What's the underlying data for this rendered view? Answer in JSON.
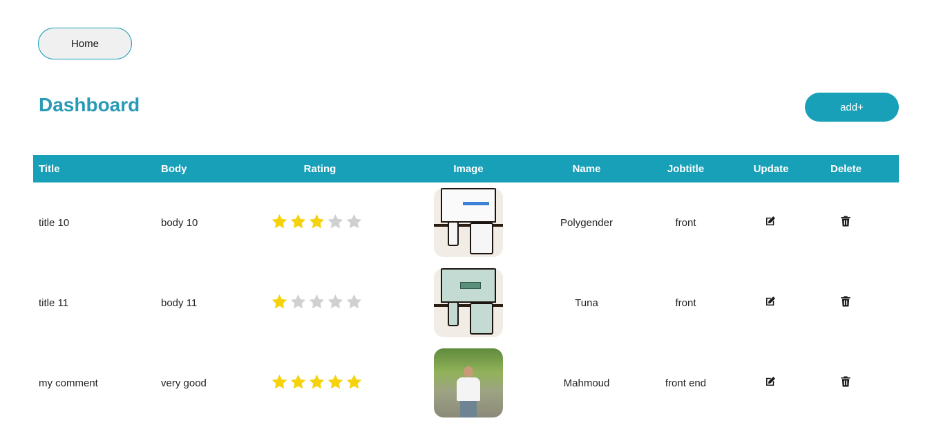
{
  "nav": {
    "home_label": "Home"
  },
  "header": {
    "title": "Dashboard",
    "add_label": "add+"
  },
  "table": {
    "columns": [
      "Title",
      "Body",
      "Rating",
      "Image",
      "Name",
      "Jobtitle",
      "Update",
      "Delete"
    ],
    "rows": [
      {
        "title": "title 10",
        "body": "body 10",
        "rating": 3,
        "image": "devices-mockup-white",
        "name": "Polygender",
        "jobtitle": "front"
      },
      {
        "title": "title 11",
        "body": "body 11",
        "rating": 1,
        "image": "devices-mockup-mint",
        "name": "Tuna",
        "jobtitle": "front"
      },
      {
        "title": "my comment",
        "body": "very good",
        "rating": 5,
        "image": "person-photo",
        "name": "Mahmoud",
        "jobtitle": "front end"
      }
    ]
  },
  "icons": {
    "update": "edit-icon",
    "delete": "trash-icon",
    "star": "star-icon"
  },
  "colors": {
    "accent": "#17a0b7",
    "title": "#2a9bb6",
    "star_on": "#f5d20b",
    "star_off": "#d0d0d0"
  },
  "rating_max": 5
}
